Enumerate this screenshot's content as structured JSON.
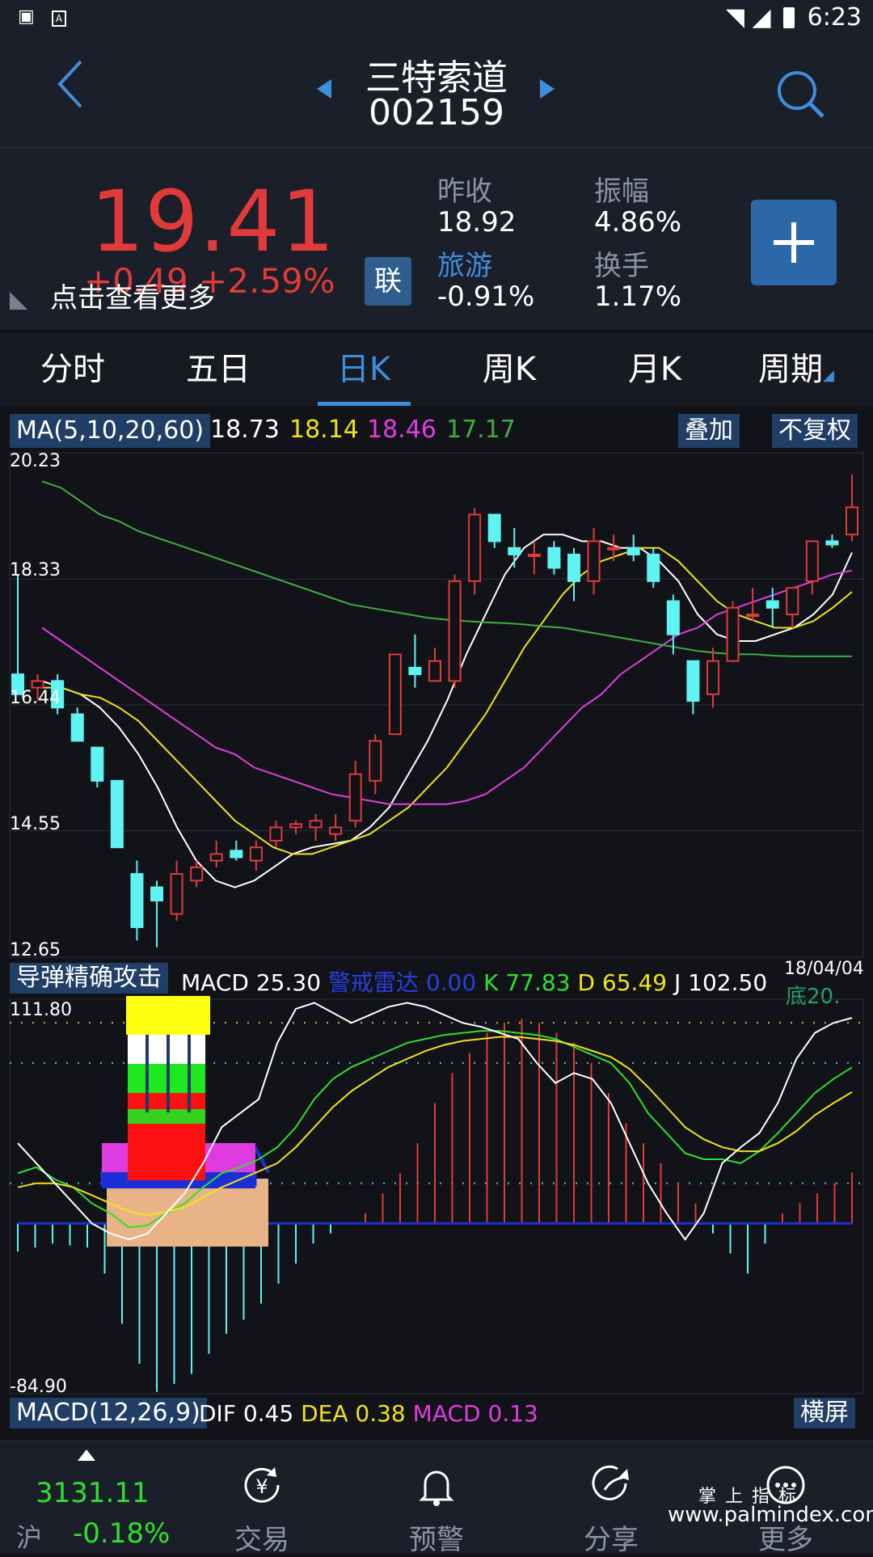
{
  "status": {
    "time": "6:23",
    "icons": [
      "image-icon",
      "a-notification-icon",
      "wifi-icon",
      "signal-icon",
      "battery-icon"
    ]
  },
  "header": {
    "name": "三特索道",
    "code": "002159"
  },
  "quote": {
    "price": "19.41",
    "change_partial": "+0.49  +2.59%",
    "more_hint": "点击查看更多",
    "lian": "联",
    "prev_close_label": "昨收",
    "prev_close": "18.92",
    "amplitude_label": "振幅",
    "amplitude": "4.86%",
    "sector_label": "旅游",
    "sector_change": "-0.91%",
    "turnover_label": "换手",
    "turnover": "1.17%"
  },
  "tabs": [
    "分时",
    "五日",
    "日K",
    "周K",
    "月K",
    "周期"
  ],
  "active_tab": 2,
  "ma": {
    "label": "MA(5,10,20,60)",
    "ma5": "18.73",
    "ma10": "18.14",
    "ma20": "18.46",
    "ma60": "17.17",
    "overlay": "叠加",
    "adjust": "不复权"
  },
  "main_axis": {
    "top": "20.23",
    "l2": "18.33",
    "l3": "16.44",
    "l4": "14.55",
    "bottom": "12.65"
  },
  "sub": {
    "indicator_label": "导弹精确攻击",
    "macd_label": "MACD",
    "macd_value": "25.30",
    "radar_label": "警戒雷达",
    "radar_value": "0.00",
    "k_label": "K",
    "k_value": "77.83",
    "d_label": "D",
    "d_value": "65.49",
    "j_label": "J",
    "j_value": "102.50",
    "bottom_label": "底",
    "bottom_value": "20.",
    "date": "18/04/04",
    "axis_top": "111.80",
    "axis_bottom": "-84.90"
  },
  "macd": {
    "label": "MACD(12,26,9)",
    "dif_label": "DIF",
    "dif": "0.45",
    "dea_label": "DEA",
    "dea": "0.38",
    "macd_label": "MACD",
    "macd": "0.13",
    "landscape": "横屏"
  },
  "nav": {
    "index_value": "3131.11",
    "index_name": "沪",
    "index_change": "-0.18%",
    "trade": "交易",
    "alert": "预警",
    "share": "分享",
    "more": "更多",
    "watermark_top": "掌 上 指 标",
    "watermark_url": "www.palmindex.com"
  },
  "colors": {
    "up": "#e03a3a",
    "down": "#5ff3f3",
    "ma5": "#ffffff",
    "ma10": "#f0e21a",
    "ma20": "#e23ce2",
    "ma60": "#3fae3f",
    "accent": "#3e8ede"
  },
  "chart_data": [
    {
      "type": "candlestick",
      "title": "",
      "ylim": [
        12.65,
        20.23
      ],
      "y_ticks": [
        20.23,
        18.33,
        16.44,
        14.55,
        12.65
      ],
      "candles": [
        {
          "o": 16.9,
          "h": 18.4,
          "l": 16.6,
          "c": 16.6
        },
        {
          "o": 16.7,
          "h": 16.9,
          "l": 16.5,
          "c": 16.8
        },
        {
          "o": 16.8,
          "h": 16.9,
          "l": 16.3,
          "c": 16.4
        },
        {
          "o": 16.3,
          "h": 16.4,
          "l": 15.9,
          "c": 15.9
        },
        {
          "o": 15.8,
          "h": 15.8,
          "l": 15.2,
          "c": 15.3
        },
        {
          "o": 15.3,
          "h": 15.3,
          "l": 14.3,
          "c": 14.3
        },
        {
          "o": 13.9,
          "h": 14.1,
          "l": 12.9,
          "c": 13.1
        },
        {
          "o": 13.7,
          "h": 13.8,
          "l": 12.8,
          "c": 13.5
        },
        {
          "o": 13.3,
          "h": 14.1,
          "l": 13.2,
          "c": 13.9
        },
        {
          "o": 13.8,
          "h": 14.1,
          "l": 13.7,
          "c": 14.0
        },
        {
          "o": 14.1,
          "h": 14.4,
          "l": 14.0,
          "c": 14.2
        },
        {
          "o": 14.25,
          "h": 14.4,
          "l": 14.1,
          "c": 14.15
        },
        {
          "o": 14.1,
          "h": 14.4,
          "l": 13.95,
          "c": 14.3
        },
        {
          "o": 14.4,
          "h": 14.7,
          "l": 14.3,
          "c": 14.6
        },
        {
          "o": 14.6,
          "h": 14.7,
          "l": 14.5,
          "c": 14.65
        },
        {
          "o": 14.6,
          "h": 14.8,
          "l": 14.4,
          "c": 14.7
        },
        {
          "o": 14.5,
          "h": 14.8,
          "l": 14.4,
          "c": 14.6
        },
        {
          "o": 14.7,
          "h": 15.6,
          "l": 14.6,
          "c": 15.4
        },
        {
          "o": 15.3,
          "h": 16.0,
          "l": 15.1,
          "c": 15.9
        },
        {
          "o": 16.0,
          "h": 17.2,
          "l": 16.0,
          "c": 17.2
        },
        {
          "o": 17.0,
          "h": 17.5,
          "l": 16.7,
          "c": 16.9
        },
        {
          "o": 16.8,
          "h": 17.3,
          "l": 16.8,
          "c": 17.1
        },
        {
          "o": 16.8,
          "h": 18.4,
          "l": 16.7,
          "c": 18.3
        },
        {
          "o": 18.3,
          "h": 19.4,
          "l": 18.1,
          "c": 19.3
        },
        {
          "o": 19.3,
          "h": 19.3,
          "l": 18.8,
          "c": 18.9
        },
        {
          "o": 18.8,
          "h": 19.1,
          "l": 18.5,
          "c": 18.7
        },
        {
          "o": 18.7,
          "h": 18.9,
          "l": 18.4,
          "c": 18.7
        },
        {
          "o": 18.8,
          "h": 18.9,
          "l": 18.4,
          "c": 18.5
        },
        {
          "o": 18.7,
          "h": 18.8,
          "l": 18.0,
          "c": 18.3
        },
        {
          "o": 18.3,
          "h": 19.1,
          "l": 18.1,
          "c": 18.9
        },
        {
          "o": 18.8,
          "h": 19.0,
          "l": 18.6,
          "c": 18.8
        },
        {
          "o": 18.8,
          "h": 19.0,
          "l": 18.6,
          "c": 18.7
        },
        {
          "o": 18.7,
          "h": 18.8,
          "l": 18.2,
          "c": 18.3
        },
        {
          "o": 18.0,
          "h": 18.1,
          "l": 17.2,
          "c": 17.5
        },
        {
          "o": 17.1,
          "h": 17.1,
          "l": 16.3,
          "c": 16.5
        },
        {
          "o": 16.6,
          "h": 17.3,
          "l": 16.4,
          "c": 17.1
        },
        {
          "o": 17.1,
          "h": 18.0,
          "l": 17.1,
          "c": 17.9
        },
        {
          "o": 17.8,
          "h": 18.2,
          "l": 17.7,
          "c": 17.8
        },
        {
          "o": 18.0,
          "h": 18.2,
          "l": 17.6,
          "c": 17.9
        },
        {
          "o": 17.8,
          "h": 18.2,
          "l": 17.6,
          "c": 18.2
        },
        {
          "o": 18.3,
          "h": 18.9,
          "l": 18.1,
          "c": 18.9
        },
        {
          "o": 18.9,
          "h": 19.0,
          "l": 18.8,
          "c": 18.85
        },
        {
          "o": 19.0,
          "h": 19.9,
          "l": 18.9,
          "c": 19.41
        }
      ],
      "series": [
        {
          "name": "MA5",
          "values": [
            16.8,
            16.7,
            16.6,
            16.4,
            16.1,
            15.7,
            15.2,
            14.6,
            14.1,
            13.8,
            13.7,
            13.8,
            14.0,
            14.2,
            14.3,
            14.35,
            14.4,
            14.6,
            14.9,
            15.4,
            15.9,
            16.5,
            17.2,
            17.8,
            18.4,
            18.8,
            19.0,
            19.0,
            18.9,
            18.9,
            18.8,
            18.8,
            18.6,
            18.3,
            17.8,
            17.5,
            17.4,
            17.4,
            17.5,
            17.6,
            17.8,
            18.1,
            18.73
          ]
        },
        {
          "name": "MA10",
          "values": [
            16.7,
            16.7,
            16.6,
            16.55,
            16.4,
            16.2,
            15.9,
            15.6,
            15.3,
            15.0,
            14.7,
            14.5,
            14.3,
            14.2,
            14.2,
            14.3,
            14.4,
            14.5,
            14.7,
            14.9,
            15.2,
            15.5,
            15.9,
            16.3,
            16.8,
            17.3,
            17.7,
            18.1,
            18.4,
            18.6,
            18.7,
            18.8,
            18.8,
            18.6,
            18.3,
            18.0,
            17.8,
            17.7,
            17.6,
            17.6,
            17.7,
            17.9,
            18.14
          ]
        },
        {
          "name": "MA20",
          "values": [
            17.6,
            17.4,
            17.2,
            17.0,
            16.8,
            16.6,
            16.4,
            16.2,
            16.0,
            15.8,
            15.7,
            15.5,
            15.4,
            15.3,
            15.2,
            15.1,
            15.05,
            15.0,
            14.95,
            14.95,
            14.95,
            14.95,
            15.0,
            15.1,
            15.3,
            15.5,
            15.8,
            16.1,
            16.4,
            16.6,
            16.9,
            17.1,
            17.3,
            17.5,
            17.6,
            17.8,
            17.9,
            18.0,
            18.1,
            18.2,
            18.3,
            18.4,
            18.46
          ]
        },
        {
          "name": "MA60",
          "values": [
            19.8,
            19.7,
            19.5,
            19.3,
            19.2,
            19.05,
            18.95,
            18.85,
            18.75,
            18.65,
            18.55,
            18.45,
            18.35,
            18.25,
            18.15,
            18.05,
            17.95,
            17.9,
            17.85,
            17.8,
            17.75,
            17.72,
            17.7,
            17.68,
            17.67,
            17.65,
            17.62,
            17.6,
            17.55,
            17.5,
            17.45,
            17.4,
            17.35,
            17.3,
            17.25,
            17.22,
            17.2,
            17.2,
            17.18,
            17.17,
            17.17,
            17.17,
            17.17
          ]
        }
      ]
    },
    {
      "type": "line",
      "title": "",
      "ylim": [
        -84.9,
        111.8
      ],
      "y_ticks": [
        111.8,
        -84.9
      ],
      "reference_levels": [
        100,
        80,
        20,
        0
      ],
      "series": [
        {
          "name": "K",
          "values": [
            25,
            28,
            22,
            18,
            10,
            5,
            -2,
            -1,
            5,
            10,
            18,
            25,
            28,
            32,
            38,
            48,
            62,
            72,
            78,
            82,
            86,
            90,
            92,
            94,
            95,
            96,
            96,
            95,
            94,
            92,
            88,
            84,
            80,
            70,
            55,
            45,
            35,
            32,
            32,
            30,
            36,
            45,
            55,
            65,
            72,
            77.83
          ]
        },
        {
          "name": "D",
          "values": [
            18,
            20,
            20,
            18,
            14,
            10,
            6,
            4,
            6,
            8,
            13,
            18,
            22,
            26,
            30,
            38,
            48,
            58,
            66,
            72,
            78,
            82,
            86,
            89,
            91,
            92,
            93,
            93,
            92,
            91,
            89,
            86,
            83,
            77,
            68,
            58,
            48,
            42,
            38,
            36,
            36,
            40,
            46,
            54,
            60,
            65.49
          ]
        },
        {
          "name": "J",
          "values": [
            40,
            30,
            20,
            10,
            0,
            -5,
            -8,
            -5,
            5,
            15,
            30,
            48,
            55,
            62,
            90,
            107,
            110,
            105,
            100,
            104,
            108,
            110,
            108,
            104,
            100,
            98,
            95,
            92,
            80,
            70,
            75,
            72,
            60,
            40,
            20,
            5,
            -8,
            5,
            30,
            38,
            45,
            60,
            82,
            95,
            100,
            102.5
          ]
        },
        {
          "name": "MACD",
          "values": [
            -14,
            -12,
            -10,
            -11,
            -12,
            -25,
            -50,
            -70,
            -84,
            -80,
            -75,
            -65,
            -55,
            -48,
            -40,
            -30,
            -20,
            -10,
            -5,
            0,
            5,
            15,
            25,
            40,
            60,
            75,
            85,
            95,
            100,
            102,
            100,
            95,
            90,
            80,
            65,
            50,
            40,
            30,
            20,
            10,
            -5,
            -15,
            -25,
            -10,
            5,
            10,
            15,
            20,
            25.3
          ]
        }
      ]
    }
  ]
}
